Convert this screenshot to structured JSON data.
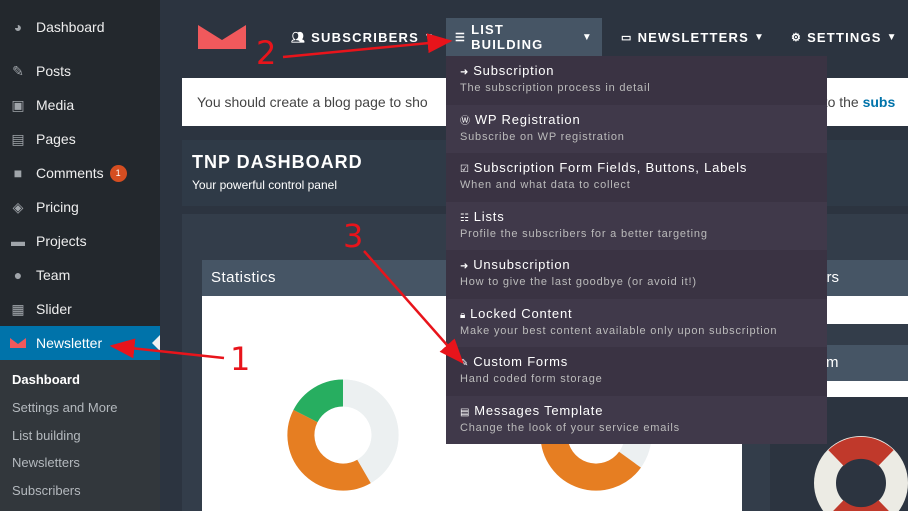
{
  "sidebar": {
    "items": [
      {
        "label": "Dashboard",
        "icon": "dashboard-icon"
      },
      {
        "label": "Posts",
        "icon": "pin-icon"
      },
      {
        "label": "Media",
        "icon": "media-icon"
      },
      {
        "label": "Pages",
        "icon": "pages-icon"
      },
      {
        "label": "Comments",
        "icon": "comment-icon",
        "badge": "1"
      },
      {
        "label": "Pricing",
        "icon": "tag-icon"
      },
      {
        "label": "Projects",
        "icon": "folder-icon"
      },
      {
        "label": "Team",
        "icon": "user-icon"
      },
      {
        "label": "Slider",
        "icon": "image-icon"
      },
      {
        "label": "Newsletter",
        "icon": "newsletter-icon"
      }
    ],
    "submenu": [
      "Dashboard",
      "Settings and More",
      "List building",
      "Newsletters",
      "Subscribers"
    ]
  },
  "nav": {
    "subscribers": "SUBSCRIBERS",
    "list_building": "LIST BUILDING",
    "newsletters": "NEWSLETTERS",
    "settings": "SETTINGS"
  },
  "notice": {
    "text": "You should create a blog page to sho",
    "right_text": "o to the ",
    "link": "subs"
  },
  "header": {
    "title": "TNP DASHBOARD",
    "subtitle": "Your powerful control panel"
  },
  "panels": {
    "statistics": "Statistics",
    "right1": "ters",
    "right2": "m"
  },
  "dropdown": [
    {
      "title": "Subscription",
      "desc": "The subscription process in detail",
      "icon": "sign-in-icon"
    },
    {
      "title": "WP Registration",
      "desc": "Subscribe on WP registration",
      "icon": "wordpress-icon"
    },
    {
      "title": "Subscription Form Fields, Buttons, Labels",
      "desc": "When and what data to collect",
      "icon": "checkbox-icon"
    },
    {
      "title": "Lists",
      "desc": "Profile the subscribers for a better targeting",
      "icon": "list-icon"
    },
    {
      "title": "Unsubscription",
      "desc": "How to give the last goodbye (or avoid it!)",
      "icon": "sign-out-icon"
    },
    {
      "title": "Locked Content",
      "desc": "Make your best content available only upon subscription",
      "icon": "lock-icon"
    },
    {
      "title": "Custom Forms",
      "desc": "Hand coded form storage",
      "icon": "pencil-icon"
    },
    {
      "title": "Messages Template",
      "desc": "Change the look of your service emails",
      "icon": "file-icon"
    }
  ],
  "annotations": [
    "1",
    "2",
    "3"
  ],
  "colors": {
    "accent_red": "#e8141b",
    "wp_active": "#0073aa",
    "donut_orange": "#e67e22",
    "donut_green": "#27ae60",
    "donut_grey": "#ecf0f1"
  }
}
